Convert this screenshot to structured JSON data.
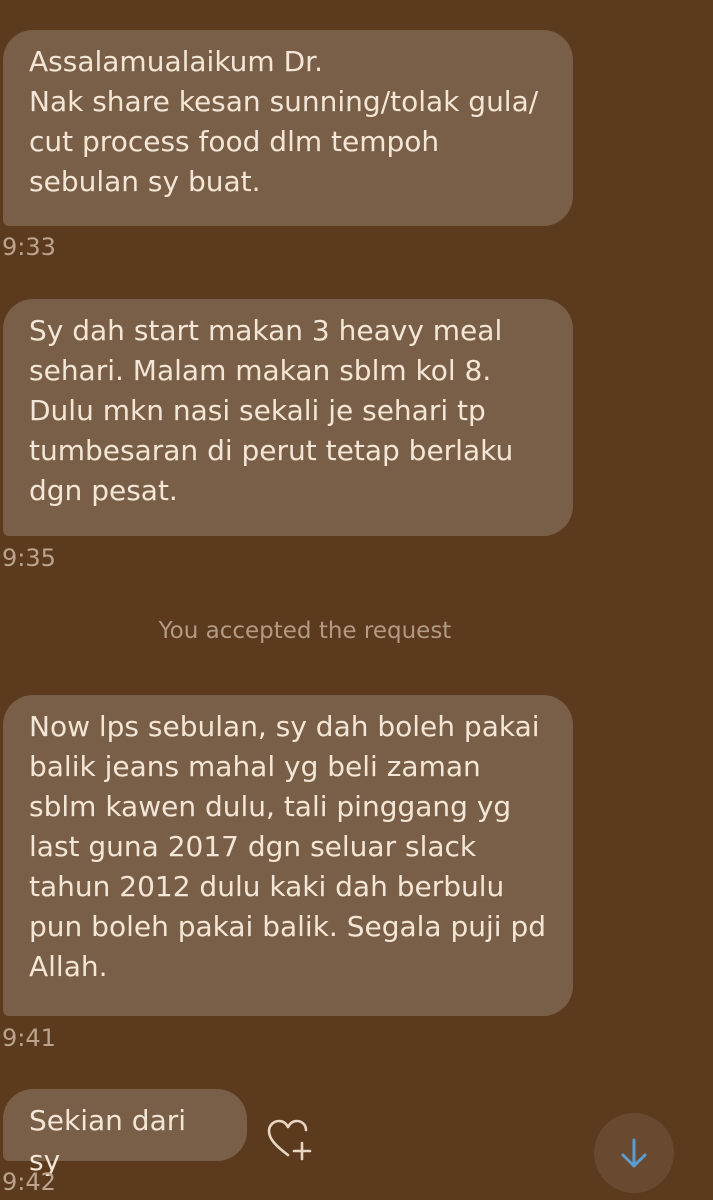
{
  "messages": [
    {
      "text": "Assalamualaikum Dr.\nNak share kesan sunning/tolak gula/\ncut process food dlm tempoh\nsebulan sy buat.",
      "time": "9:33"
    },
    {
      "text": "Sy dah start makan 3 heavy meal\nsehari. Malam makan sblm kol 8.\nDulu mkn nasi sekali je sehari tp\ntumbesaran di perut tetap berlaku\ndgn pesat.",
      "time": "9:35"
    },
    {
      "text": "Now lps sebulan, sy dah boleh pakai\nbalik jeans mahal yg beli zaman\nsblm kawen dulu, tali pinggang yg\nlast guna 2017 dgn seluar slack\ntahun 2012 dulu kaki dah berbulu\npun boleh pakai balik. Segala puji pd\nAllah.",
      "time": "9:41"
    },
    {
      "text": "Sekian dari sy",
      "time": "9:42"
    }
  ],
  "system_message": "You accepted the request",
  "icons": {
    "react": "heart-plus-icon",
    "scroll": "arrow-down-icon"
  },
  "colors": {
    "background": "#5c3a1e",
    "bubble": "#7a5f48",
    "bubble_text": "#f3e6d6",
    "timestamp": "#bba48e",
    "scroll_arrow": "#5a9bd0"
  }
}
